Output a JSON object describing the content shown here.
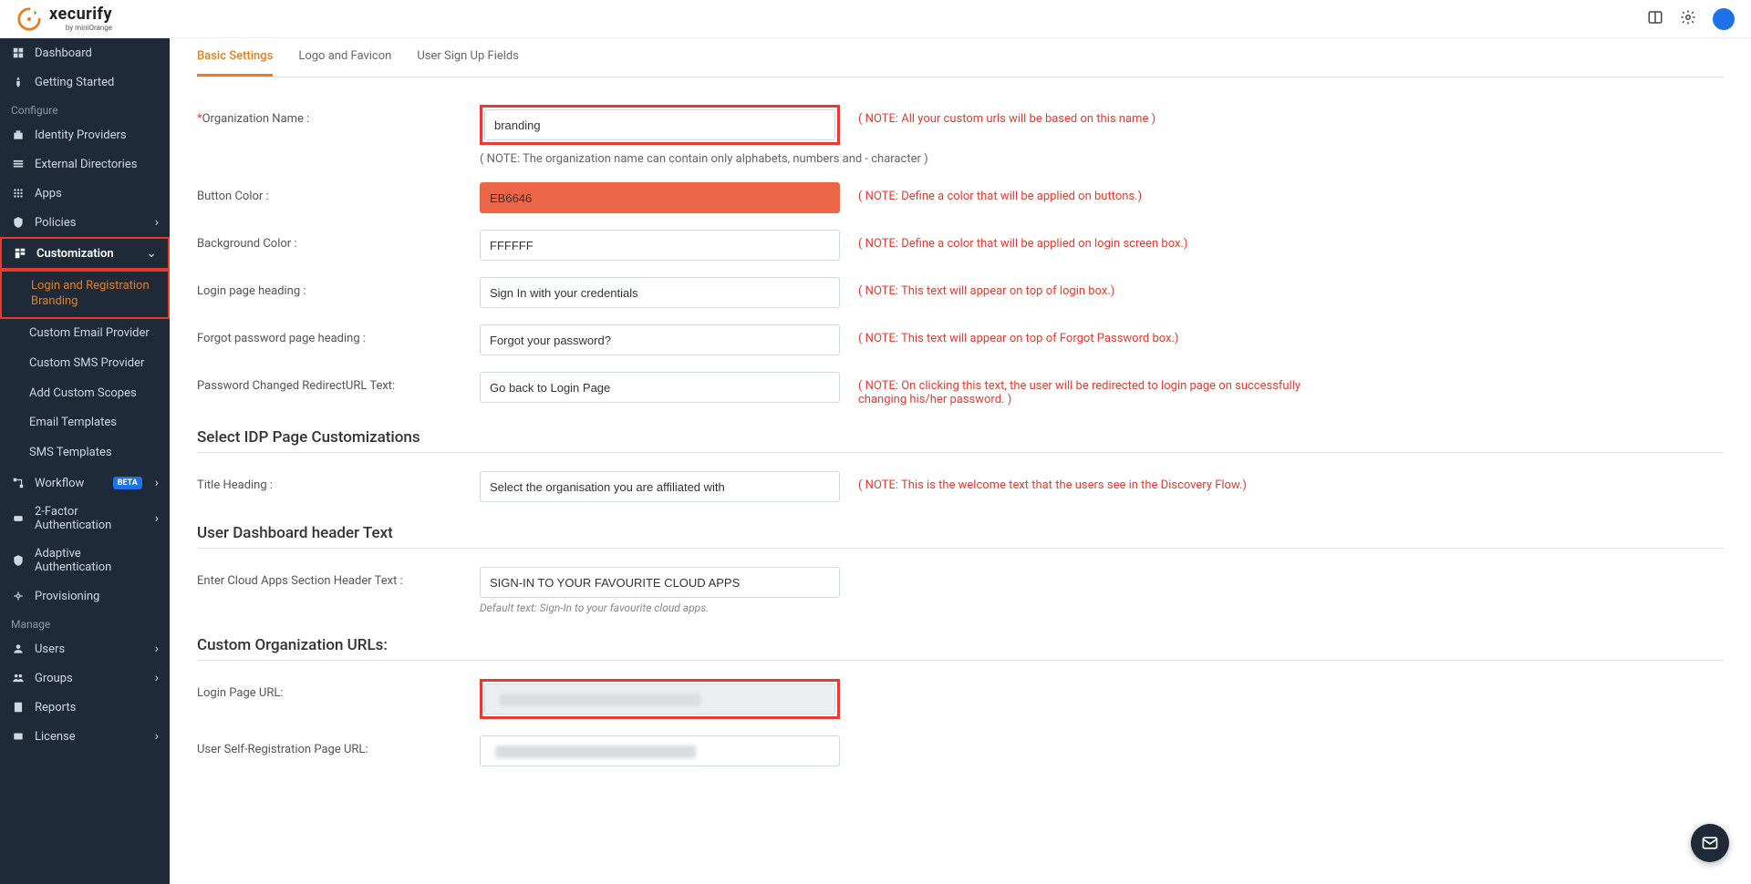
{
  "header": {
    "logo_main": "xecurify",
    "logo_sub": "by miniOrange"
  },
  "sidebar": {
    "primary": [
      {
        "icon": "dashboard",
        "label": "Dashboard"
      },
      {
        "icon": "rocket",
        "label": "Getting Started"
      }
    ],
    "section1": "Configure",
    "configure": [
      {
        "icon": "idp",
        "label": "Identity Providers"
      },
      {
        "icon": "dir",
        "label": "External Directories"
      },
      {
        "icon": "apps",
        "label": "Apps"
      },
      {
        "icon": "policies",
        "label": "Policies",
        "chevron": "right"
      },
      {
        "icon": "customization",
        "label": "Customization",
        "chevron": "down",
        "active": true,
        "bold": true
      }
    ],
    "customization_sub": [
      {
        "label": "Login and Registration Branding",
        "active": true
      },
      {
        "label": "Custom Email Provider"
      },
      {
        "label": "Custom SMS Provider"
      },
      {
        "label": "Add Custom Scopes"
      },
      {
        "label": "Email Templates"
      },
      {
        "label": "SMS Templates"
      }
    ],
    "configure2": [
      {
        "icon": "workflow",
        "label": "Workflow",
        "beta": "BETA",
        "chevron": "right"
      },
      {
        "icon": "twofa",
        "label": "2-Factor Authentication",
        "chevron": "right"
      },
      {
        "icon": "adaptive",
        "label": "Adaptive Authentication"
      },
      {
        "icon": "provisioning",
        "label": "Provisioning"
      }
    ],
    "section2": "Manage",
    "manage": [
      {
        "icon": "users",
        "label": "Users",
        "chevron": "right"
      },
      {
        "icon": "groups",
        "label": "Groups",
        "chevron": "right"
      },
      {
        "icon": "reports",
        "label": "Reports"
      },
      {
        "icon": "license",
        "label": "License",
        "chevron": "right"
      }
    ]
  },
  "tabs": [
    {
      "label": "Basic Settings",
      "active": true
    },
    {
      "label": "Logo and Favicon"
    },
    {
      "label": "User Sign Up Fields"
    }
  ],
  "form": {
    "org_name": {
      "label": "Organization Name :",
      "value": "branding",
      "note": "( NOTE: All your custom urls will be based on this name )"
    },
    "org_name_help": "( NOTE: The organization name can contain only alphabets, numbers and - character )",
    "button_color": {
      "label": "Button Color :",
      "value": "EB6646",
      "note": "( NOTE: Define a color that will be applied on buttons.)"
    },
    "bg_color": {
      "label": "Background Color :",
      "value": "FFFFFF",
      "note": "( NOTE: Define a color that will be applied on login screen box.)"
    },
    "login_heading": {
      "label": "Login page heading :",
      "value": "Sign In with your credentials",
      "note": "( NOTE: This text will appear on top of login box.)"
    },
    "forgot_heading": {
      "label": "Forgot password page heading :",
      "value": "Forgot your password?",
      "note": "( NOTE: This text will appear on top of Forgot Password box.)"
    },
    "pwd_redirect": {
      "label": "Password Changed RedirectURL Text:",
      "value": "Go back to Login Page",
      "note": "( NOTE: On clicking this text, the user will be redirected to login page on successfully changing his/her password. )"
    }
  },
  "idp_section": {
    "heading": "Select IDP Page Customizations",
    "title_heading": {
      "label": "Title Heading :",
      "value": "Select the organisation you are affiliated with",
      "note": "( NOTE: This is the welcome text that the users see in the Discovery Flow.)"
    }
  },
  "dashboard_section": {
    "heading": "User Dashboard header Text",
    "cloud_apps": {
      "label": "Enter Cloud Apps Section Header Text :",
      "value": "SIGN-IN TO YOUR FAVOURITE CLOUD APPS",
      "help": "Default text: Sign-In to your favourite cloud apps."
    }
  },
  "urls_section": {
    "heading": "Custom Organization URLs:",
    "login": {
      "label": "Login Page URL:"
    },
    "selfreg": {
      "label": "User Self-Registration Page URL:"
    }
  }
}
